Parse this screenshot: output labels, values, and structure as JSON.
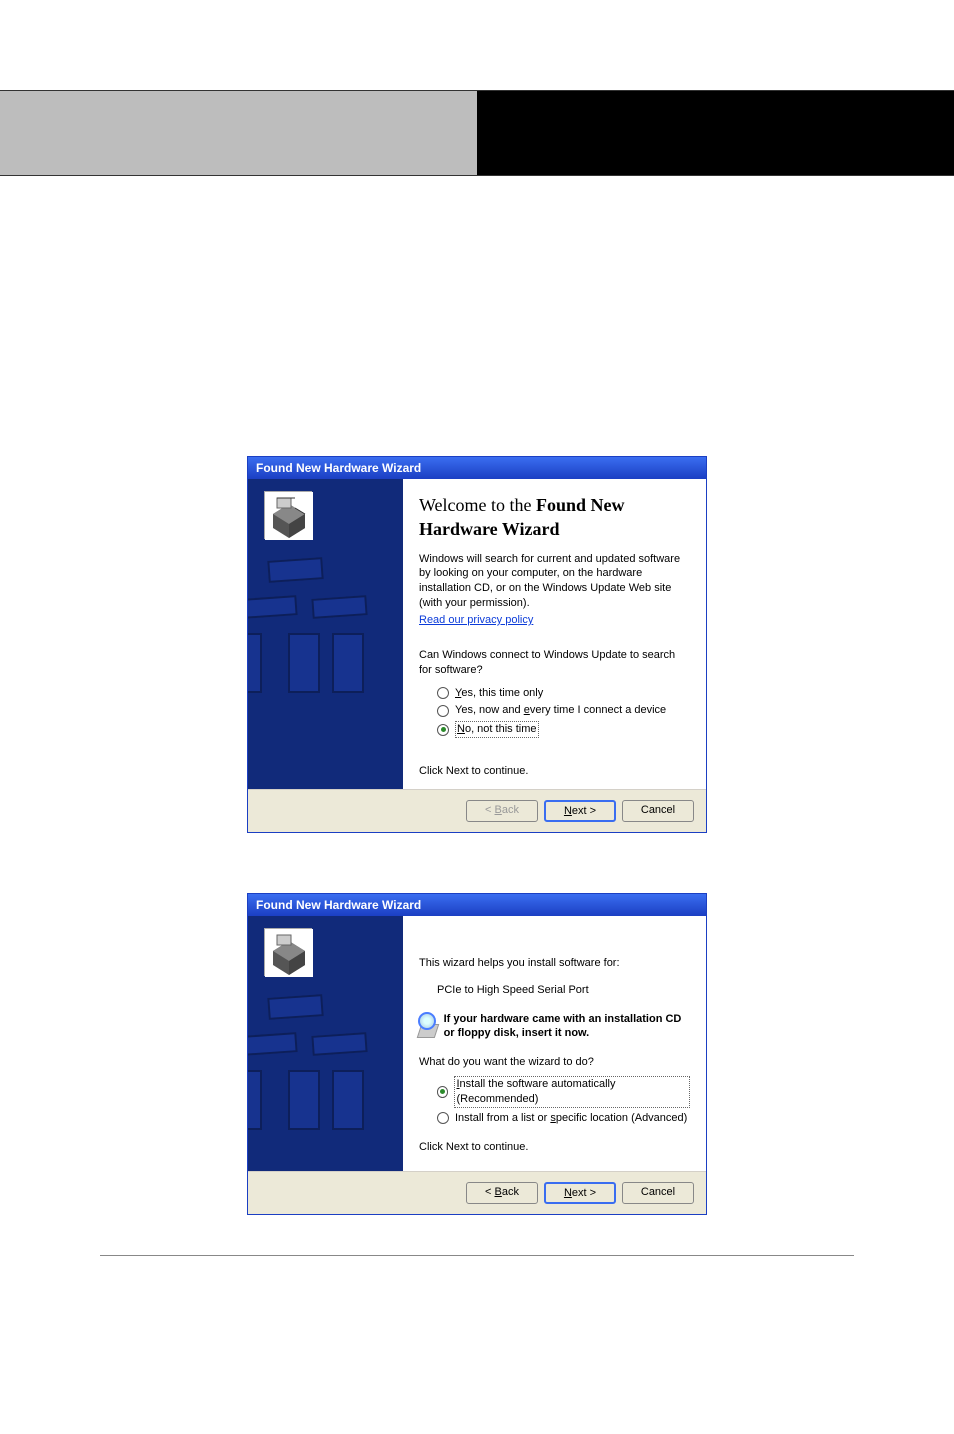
{
  "wizard1": {
    "title": "Found New Hardware Wizard",
    "heading_pre": "Welcome to the ",
    "heading_bold": "Found New",
    "heading_line2": "Hardware Wizard",
    "intro": "Windows will search for current and updated software by looking on your computer, on the hardware installation CD, or on the Windows Update Web site (with your permission).",
    "privacy_link": "Read our privacy policy",
    "question": "Can Windows connect to Windows Update to search for software?",
    "opt1_pre": "Y",
    "opt1_rest": "es, this time only",
    "opt2_pre": "Yes, now and ",
    "opt2_u": "e",
    "opt2_rest": "very time I connect a device",
    "opt3_pre": "N",
    "opt3_rest": "o, not this time",
    "continue": "Click Next to continue.",
    "back_label_pre": "< ",
    "back_u": "B",
    "back_rest": "ack",
    "next_u": "N",
    "next_rest": "ext >",
    "cancel": "Cancel"
  },
  "wizard2": {
    "title": "Found New Hardware Wizard",
    "help_text": "This wizard helps you install software for:",
    "device": "PCIe to High Speed Serial Port",
    "cd_text": "If your hardware came with an installation CD or floppy disk, insert it now.",
    "question": "What do you want the wizard to do?",
    "opt1_pre": "I",
    "opt1_rest": "nstall the software automatically (Recommended)",
    "opt2_pre": "Install from a list or ",
    "opt2_u": "s",
    "opt2_rest": "pecific location (Advanced)",
    "continue": "Click Next to continue.",
    "back_label_pre": "< ",
    "back_u": "B",
    "back_rest": "ack",
    "next_u": "N",
    "next_rest": "ext >",
    "cancel": "Cancel"
  }
}
